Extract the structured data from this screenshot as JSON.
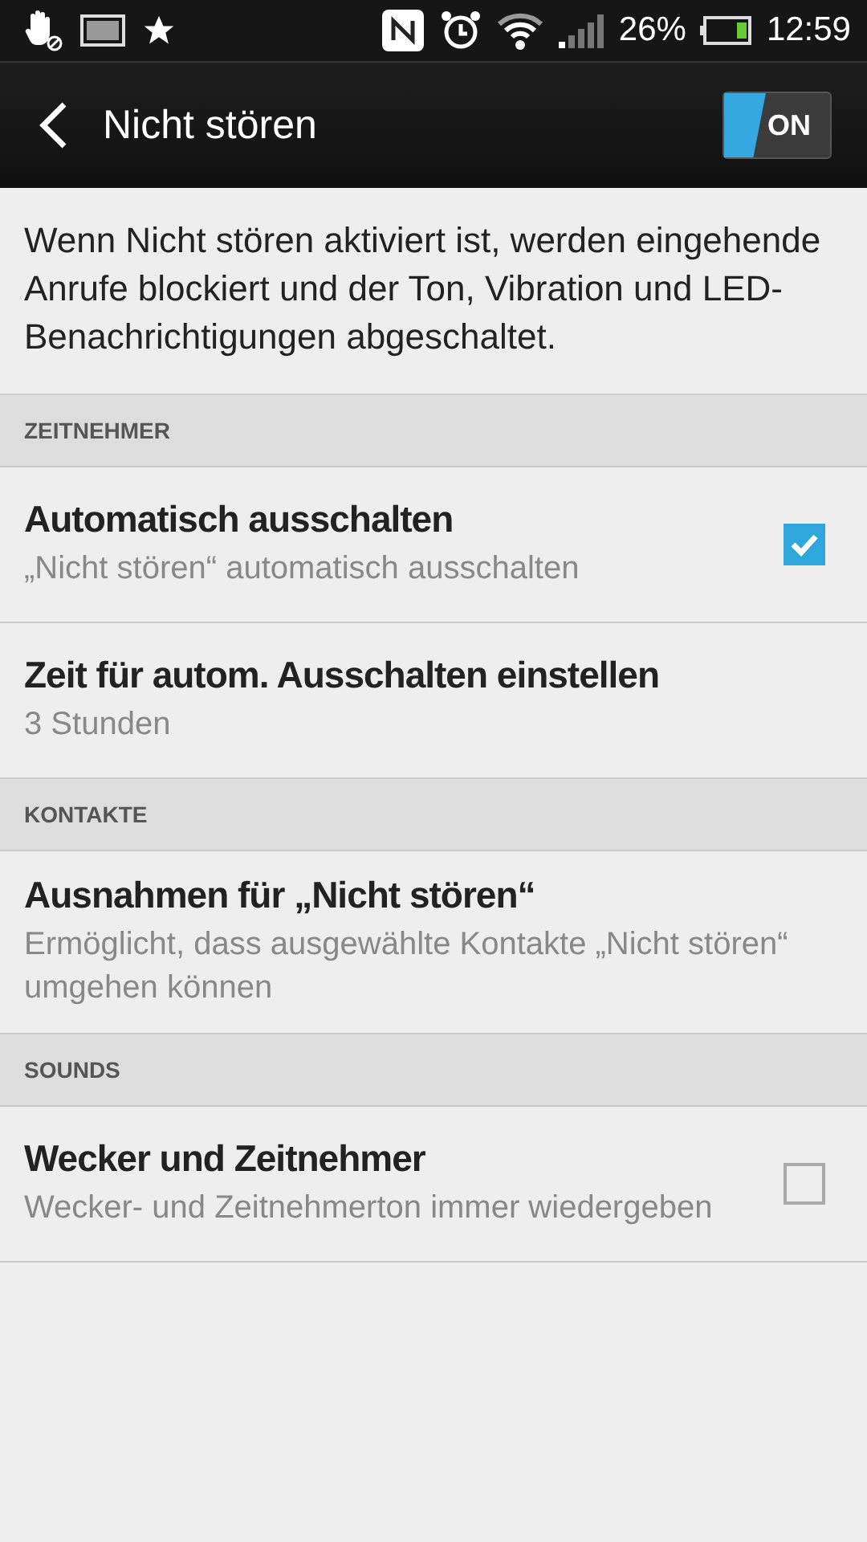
{
  "status_bar": {
    "battery": "26%",
    "time": "12:59"
  },
  "header": {
    "title": "Nicht stören",
    "toggle": {
      "label": "ON",
      "on": true
    }
  },
  "description": "Wenn Nicht stören aktiviert ist, werden eingehende Anrufe blockiert und der Ton, Vibration und LED-Benachrichtigungen abgeschaltet.",
  "sections": [
    {
      "title": "ZEITNEHMER",
      "items": [
        {
          "kind": "checkbox",
          "title": "Automatisch ausschalten",
          "summary": "„Nicht stören“ automatisch ausschalten",
          "checked": true
        },
        {
          "kind": "plain",
          "title": "Zeit für autom. Ausschalten einstellen",
          "summary": "3 Stunden"
        }
      ]
    },
    {
      "title": "KONTAKTE",
      "items": [
        {
          "kind": "plain",
          "title": "Ausnahmen für „Nicht stören“",
          "summary": "Ermöglicht, dass ausgewählte Kontakte „Nicht stören“ umgehen können"
        }
      ]
    },
    {
      "title": "SOUNDS",
      "items": [
        {
          "kind": "checkbox",
          "title": "Wecker und Zeitnehmer",
          "summary": "Wecker- und Zeitnehmerton immer wiedergeben",
          "checked": false
        }
      ]
    }
  ]
}
